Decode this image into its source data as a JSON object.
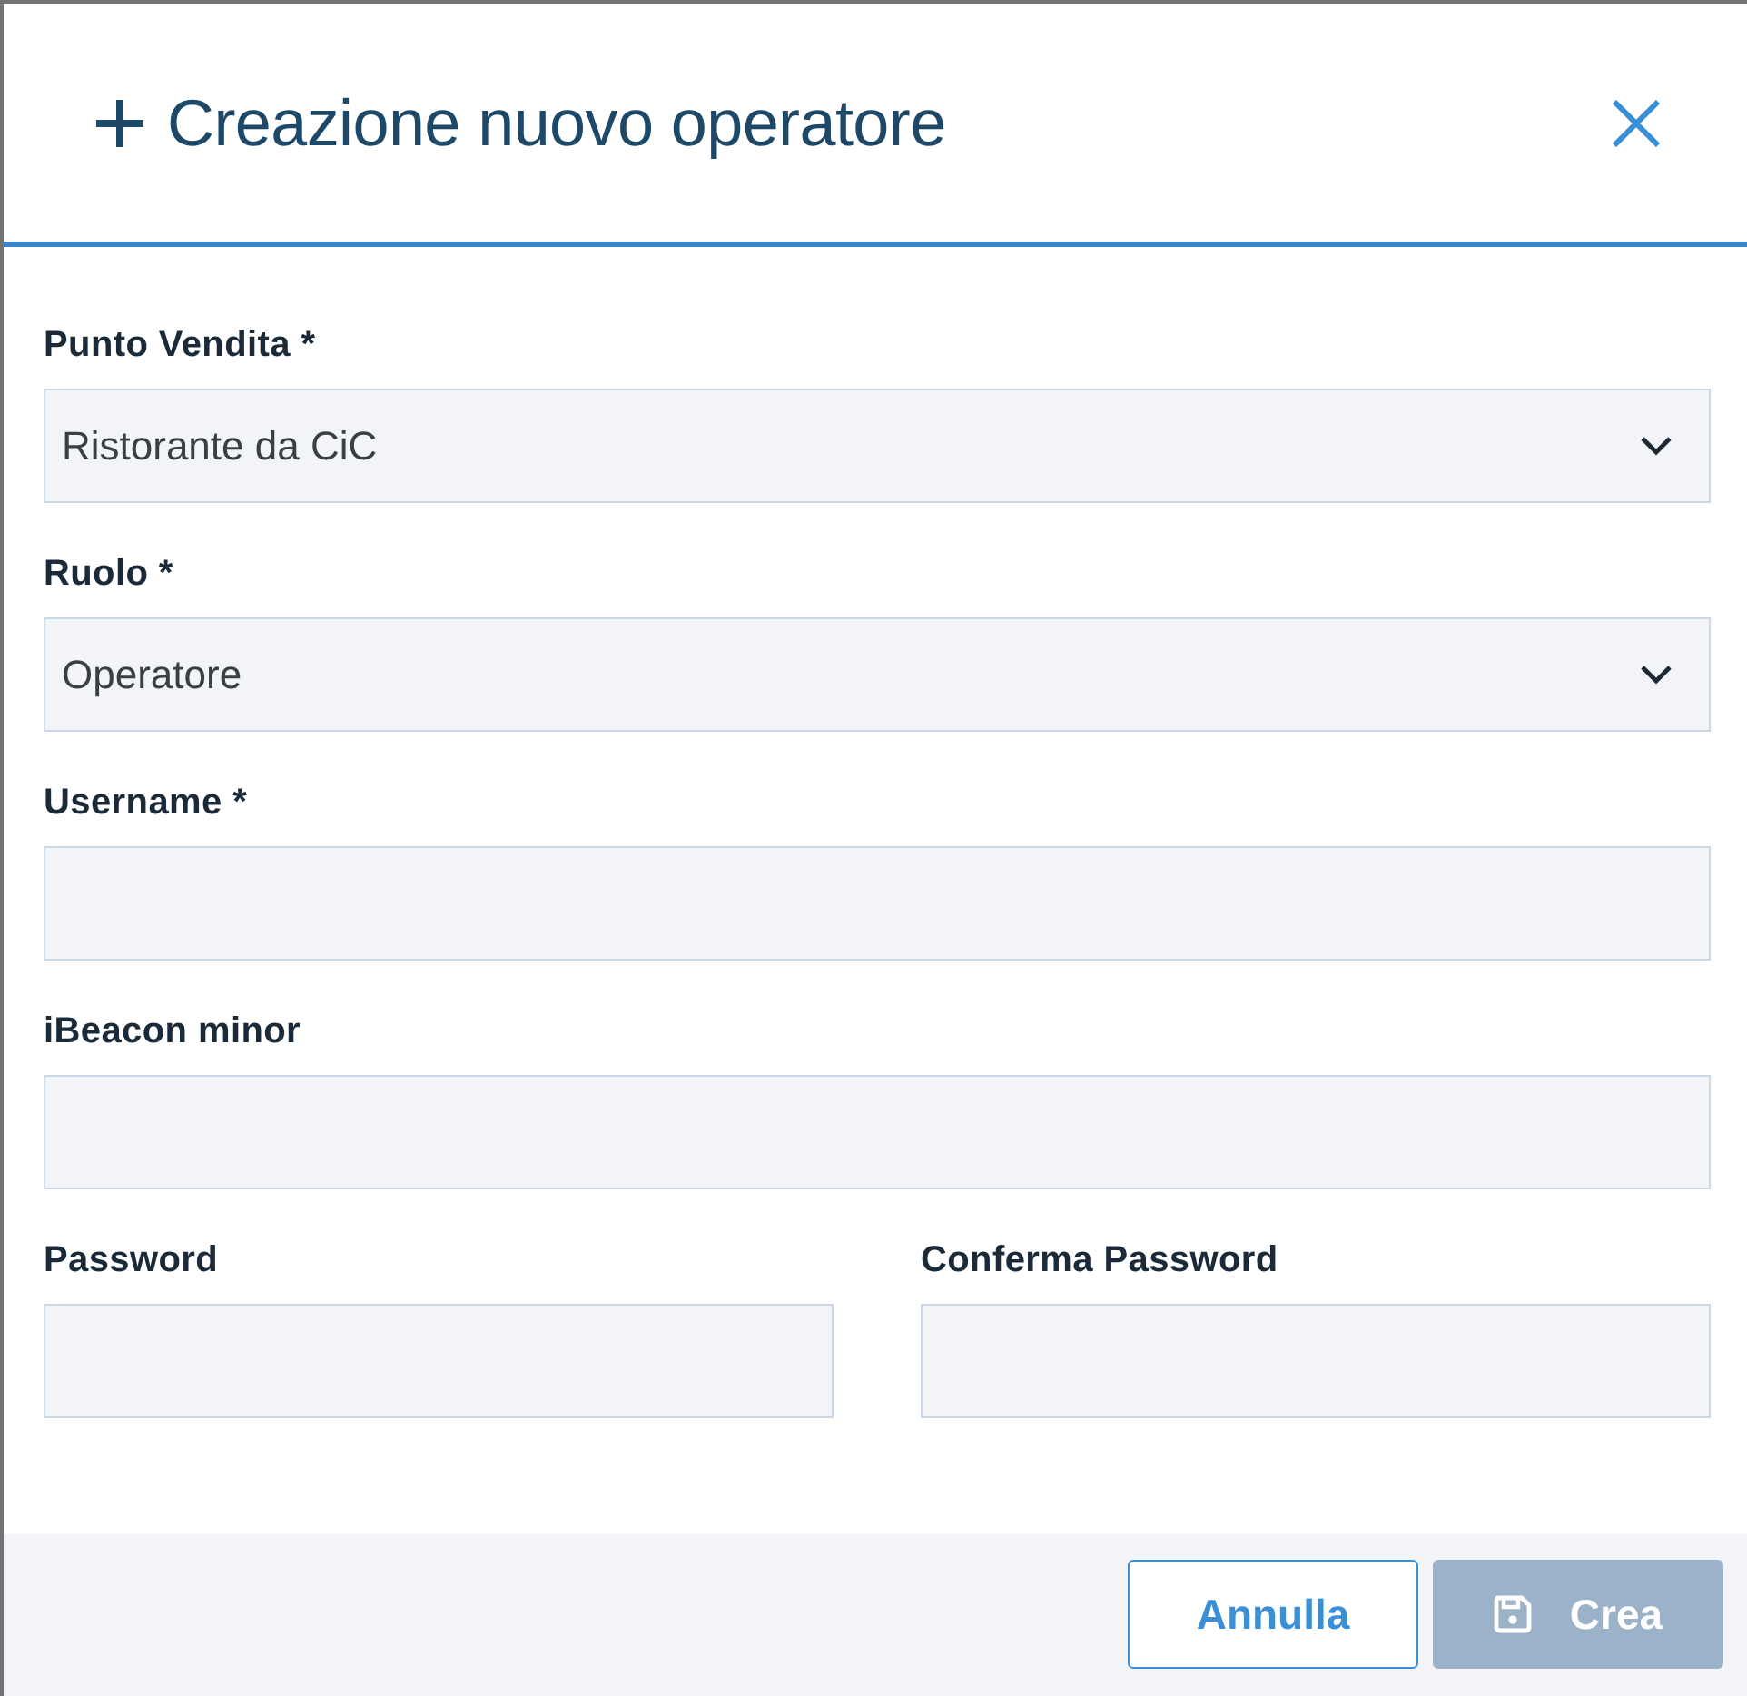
{
  "dialog": {
    "title": "Creazione nuovo operatore"
  },
  "form": {
    "rows": [
      {
        "fields": [
          {
            "kind": "select",
            "label": "Punto Vendita *",
            "value": "Ristorante da CiC"
          }
        ]
      },
      {
        "fields": [
          {
            "kind": "select",
            "label": "Ruolo *",
            "value": "Operatore"
          }
        ]
      },
      {
        "fields": [
          {
            "kind": "text",
            "label": "Username *"
          }
        ]
      },
      {
        "fields": [
          {
            "kind": "text",
            "label": "iBeacon minor"
          }
        ]
      },
      {
        "fields": [
          {
            "kind": "password",
            "label": "Password"
          },
          {
            "kind": "password",
            "label": "Conferma Password"
          }
        ]
      }
    ]
  },
  "buttons": [
    {
      "kind": "secondary",
      "label": "Annulla",
      "disabled": false
    },
    {
      "kind": "primary",
      "label": "Crea",
      "disabled": true
    }
  ]
}
